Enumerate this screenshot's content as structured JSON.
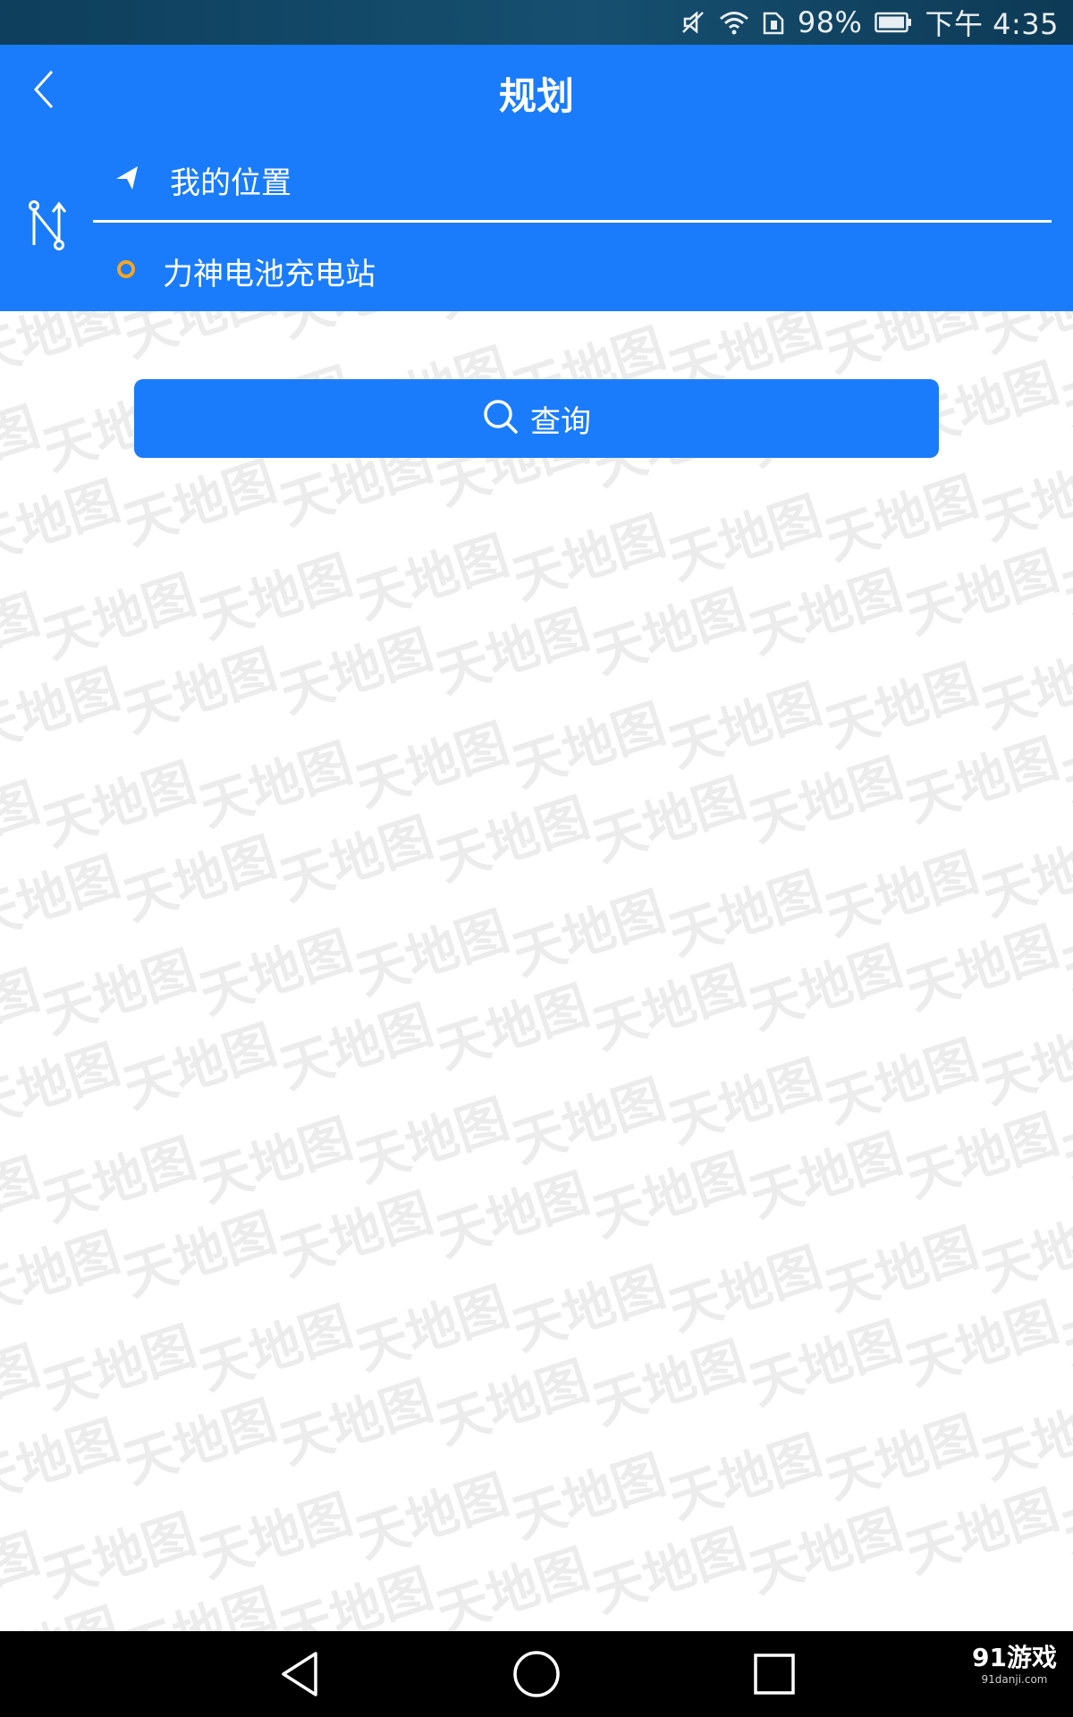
{
  "status_bar": {
    "battery_percent": "98%",
    "time": "下午 4:35",
    "icons": [
      "mute-icon",
      "wifi-icon",
      "sim-icon",
      "battery-icon"
    ]
  },
  "header": {
    "title": "规划",
    "back_icon": "chevron-left-icon",
    "swap_icon": "swap-route-icon"
  },
  "route": {
    "origin": {
      "label": "我的位置",
      "icon": "location-arrow-icon"
    },
    "destination": {
      "label": "力神电池充电站",
      "icon": "destination-circle-icon",
      "icon_color": "#f5a623"
    }
  },
  "query_button": {
    "label": "查询",
    "icon": "search-icon"
  },
  "watermark": {
    "text": "天地图"
  },
  "nav_bar": {
    "items": [
      "back-icon",
      "home-icon",
      "recent-apps-icon"
    ],
    "site_logo": "91游戏",
    "site_url": "91danji.com"
  },
  "colors": {
    "primary": "#1a7cfa",
    "status_bar": "#164f70",
    "nav_bar": "#000000",
    "destination_marker": "#f5a623"
  }
}
